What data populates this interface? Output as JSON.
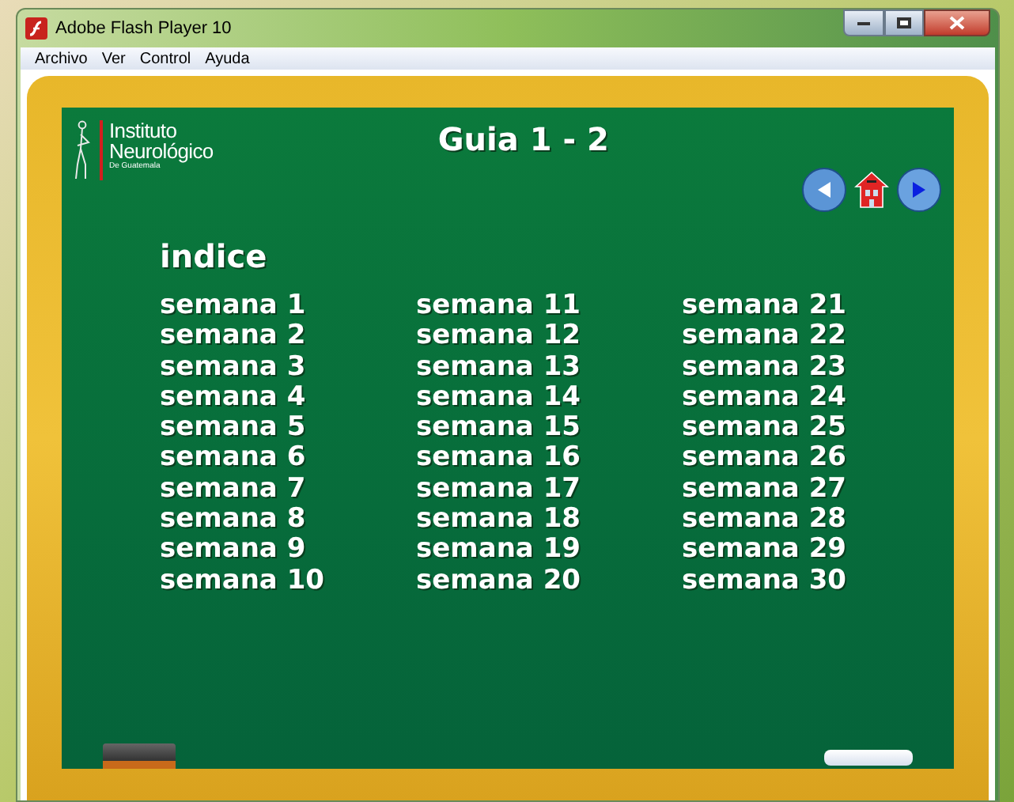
{
  "window": {
    "title": "Adobe Flash Player 10"
  },
  "menu": [
    "Archivo",
    "Ver",
    "Control",
    "Ayuda"
  ],
  "logo": {
    "line1": "Instituto",
    "line2": "Neurológico",
    "line3": "De Guatemala"
  },
  "title": "Guia 1 - 2",
  "index_title": "indice",
  "columns": [
    [
      "semana 1",
      "semana 2",
      "semana 3",
      "semana 4",
      "semana 5",
      "semana 6",
      "semana 7",
      "semana 8",
      "semana 9",
      "semana 10"
    ],
    [
      "semana 11",
      "semana 12",
      "semana 13",
      "semana 14",
      "semana 15",
      "semana 16",
      "semana 17",
      "semana 18",
      "semana 19",
      "semana 20"
    ],
    [
      "semana 21",
      "semana 22",
      "semana 23",
      "semana 24",
      "semana 25",
      "semana 26",
      "semana 27",
      "semana 28",
      "semana 29",
      "semana 30"
    ]
  ]
}
